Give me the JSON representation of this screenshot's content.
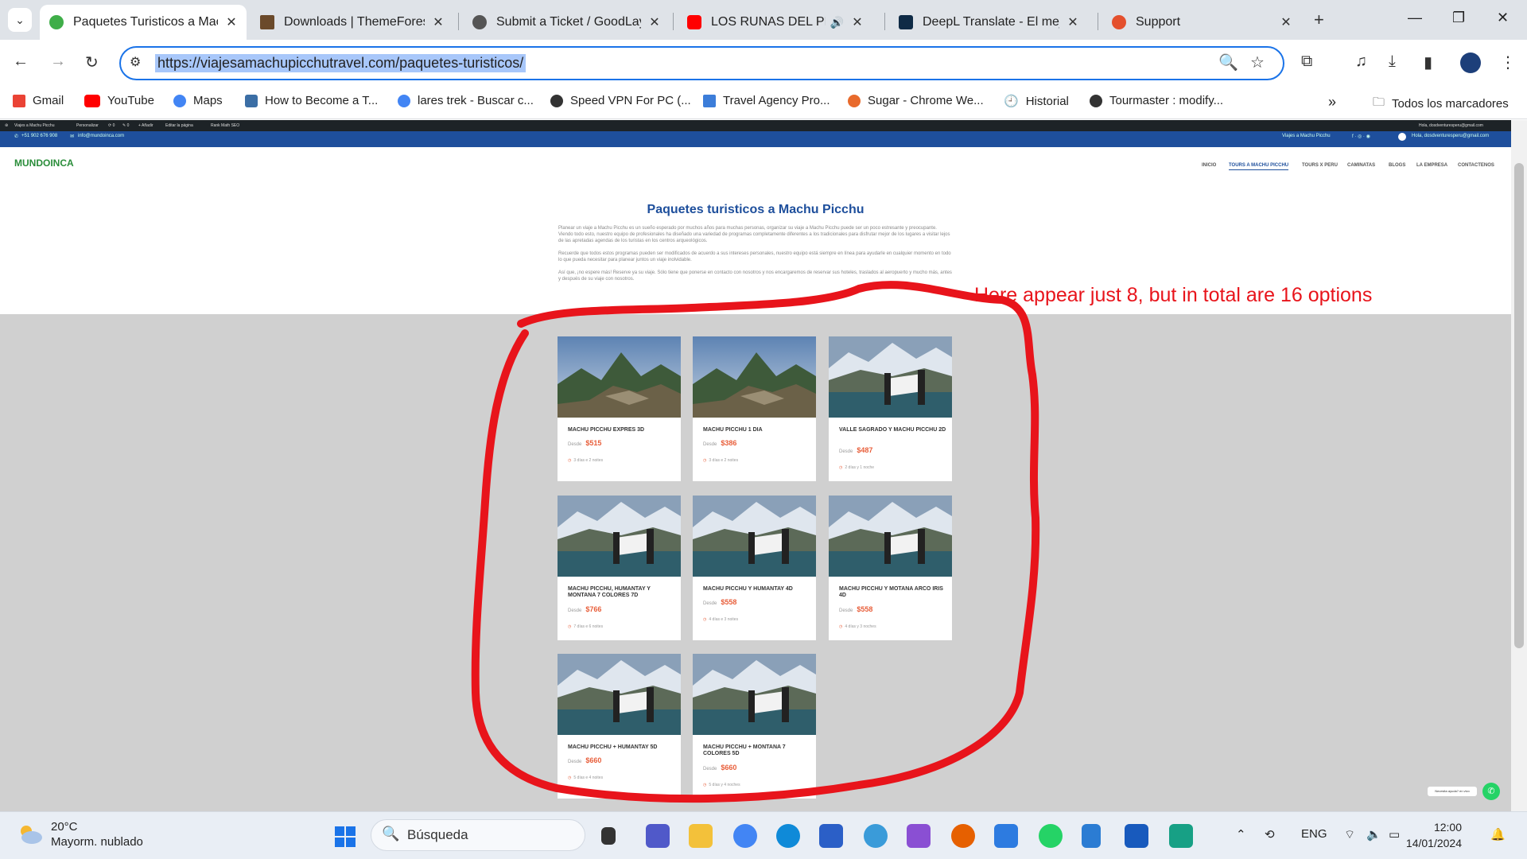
{
  "browser": {
    "tabs": [
      {
        "title": "Paquetes Turisticos a Machu Picchu",
        "active": true
      },
      {
        "title": "Downloads | ThemeForest"
      },
      {
        "title": "Submit a Ticket / GoodLayers"
      },
      {
        "title": "LOS RUNAS DEL PERÚ"
      },
      {
        "title": "DeepL Translate - El mejor"
      },
      {
        "title": "Support"
      }
    ],
    "url": "https://viajesamachupicchutravel.com/paquetes-turisticos/",
    "bookmarks": [
      "Gmail",
      "YouTube",
      "Maps",
      "How to Become a T...",
      "lares trek - Buscar c...",
      "Speed VPN For PC (...",
      "Travel Agency Pro...",
      "Sugar - Chrome We...",
      "Historial",
      "Tourmaster : modify..."
    ],
    "all_bookmarks_label": "Todos los marcadores"
  },
  "site": {
    "admin_items": [
      "Viajes a Machu Picchu",
      "Personalizar",
      "0",
      "0",
      "Añadir",
      "Editar la página",
      "Rank Math SEO"
    ],
    "phone": "+51 902 676 908",
    "email": "info@mundoinca.com",
    "topbar_right": "Viajes a Machu Picchu",
    "admin_user": "Hola, dosdventuresperu@gmail.com",
    "logo": "MUNDOINCA",
    "nav": [
      "INICIO",
      "TOURS A MACHU PICCHU",
      "TOURS X PERU",
      "CAMINATAS",
      "BLOGS",
      "LA EMPRESA",
      "CONTACTENOS"
    ],
    "page_title": "Paquetes turisticos a Machu Picchu",
    "intro_paragraphs": [
      "Planear un viaje a Machu Picchu es un sueño esperado por muchos años para muchas personas, organizar su viaje a Machu Picchu puede ser un poco estresante y preocupante. Viendo todo esto, nuestro equipo de profesionales ha diseñado una variedad de programas completamente diferentes a los tradicionales para disfrutar mejor de los lugares a visitar lejos de las apretadas agendas de los turistas en los centros arqueológicos.",
      "Recuerde que todos estos programas pueden ser modificados de acuerdo a sus intereses personales, nuestro equipo está siempre en línea para ayudarle en cualquier momento en todo lo que pueda necesitar para planear juntos un viaje inolvidable.",
      "Así que, ¡no espere más! Reserve ya su viaje. Sólo tiene que ponerse en contacto con nosotros y nos encargaremos de reservar sus hoteles, traslados al aeropuerto y mucho más, antes y después de su viaje con nosotros."
    ],
    "price_prefix": "Desde",
    "tours": [
      {
        "name": "MACHU PICCHU EXPRES 3D",
        "price": "$515",
        "duration": "3 días e 2 noites",
        "img": "mp"
      },
      {
        "name": "MACHU PICCHU 1 DIA",
        "price": "$386",
        "duration": "3 días e 2 noites",
        "img": "mp"
      },
      {
        "name": "VALLE SAGRADO Y MACHU PICCHU 2D",
        "price": "$487",
        "duration": "2 días y 1 noche",
        "img": "lake"
      },
      {
        "name": "MACHU PICCHU, HUMANTAY Y MONTANA 7 COLORES 7D",
        "price": "$766",
        "duration": "7 días e 6 noites",
        "img": "lake"
      },
      {
        "name": "MACHU PICCHU Y HUMANTAY 4D",
        "price": "$558",
        "duration": "4 días e 3 noites",
        "img": "lake"
      },
      {
        "name": "MACHU PICCHU Y MOTANA ARCO IRIS 4D",
        "price": "$558",
        "duration": "4 días y 3 noches",
        "img": "lake"
      },
      {
        "name": "MACHU PICCHU + HUMANTAY 5D",
        "price": "$660",
        "duration": "5 días e 4 noites",
        "img": "lake"
      },
      {
        "name": "MACHU PICCHU + MONTANA 7 COLORES 5D",
        "price": "$660",
        "duration": "5 días y 4 noches",
        "img": "lake"
      }
    ],
    "chat_bubble": "Necesita ayuda? en vivo"
  },
  "annotation": "Here appear just 8, but in total are 16 options",
  "taskbar": {
    "temperature": "20°C",
    "weather": "Mayorm. nublado",
    "search_placeholder": "Búsqueda",
    "language": "ENG",
    "time": "12:00",
    "date": "14/01/2024"
  },
  "colors": {
    "brand_blue": "#1e4f9c",
    "price_orange": "#e85e3a",
    "annotation_red": "#e8141b"
  }
}
